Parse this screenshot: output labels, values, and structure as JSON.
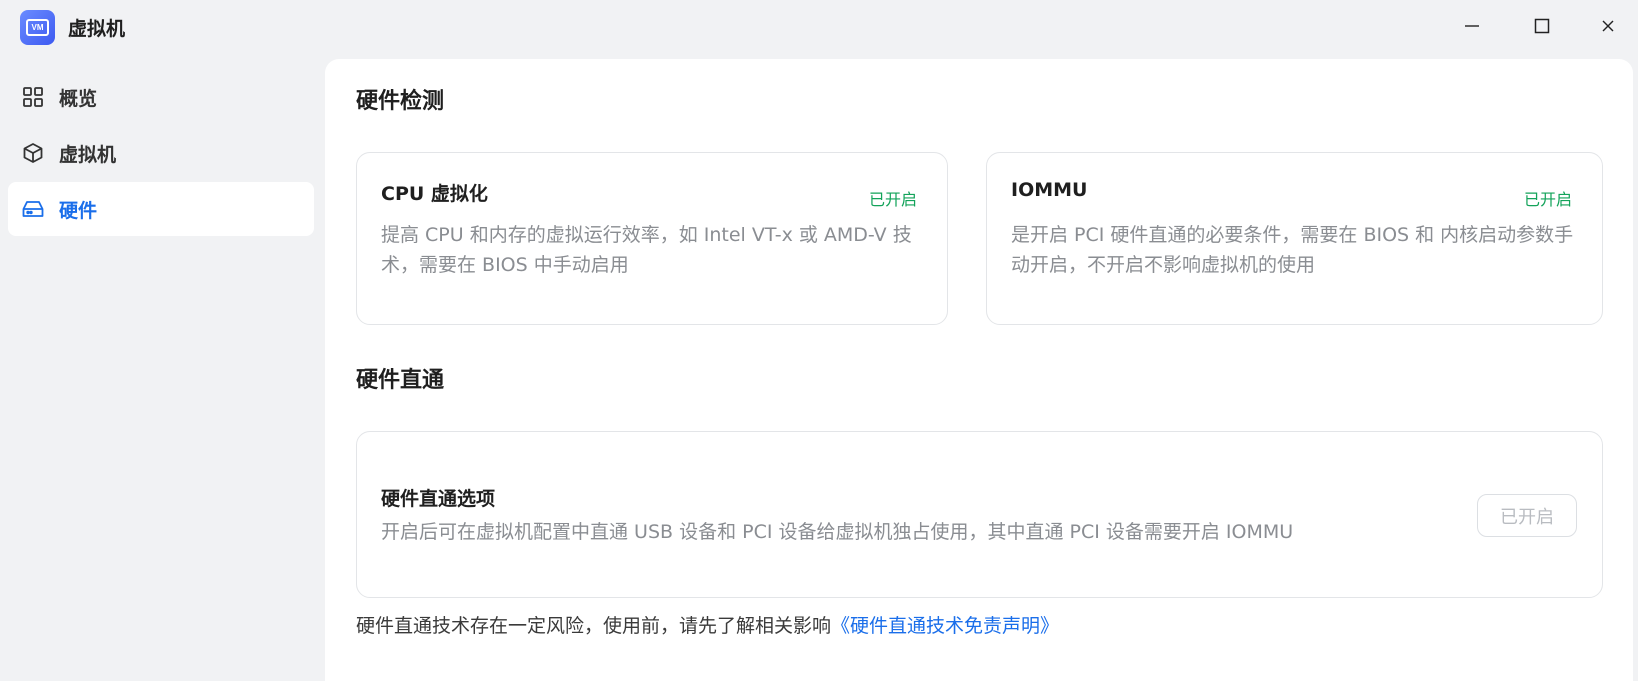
{
  "window": {
    "title": "虚拟机",
    "icon_text": "VM"
  },
  "sidebar": {
    "items": [
      {
        "label": "概览",
        "icon": "grid-icon",
        "active": false
      },
      {
        "label": "虚拟机",
        "icon": "cube-icon",
        "active": false
      },
      {
        "label": "硬件",
        "icon": "drive-icon",
        "active": true
      }
    ]
  },
  "main": {
    "detection": {
      "title": "硬件检测",
      "cards": [
        {
          "title": "CPU 虚拟化",
          "status": "已开启",
          "description": "提高 CPU 和内存的虚拟运行效率，如 Intel VT-x 或 AMD-V 技术，需要在 BIOS 中手动启用"
        },
        {
          "title": "IOMMU",
          "status": "已开启",
          "description": "是开启 PCI 硬件直通的必要条件，需要在 BIOS 和 内核启动参数手动开启，不开启不影响虚拟机的使用"
        }
      ]
    },
    "passthrough": {
      "title": "硬件直通",
      "option_title": "硬件直通选项",
      "option_description": "开启后可在虚拟机配置中直通 USB 设备和 PCI 设备给虚拟机独占使用，其中直通 PCI 设备需要开启 IOMMU",
      "button_label": "已开启"
    },
    "footer": {
      "prefix": "硬件直通技术存在一定风险，使用前，请先了解相关影响",
      "link": "《硬件直通技术免责声明》"
    }
  },
  "colors": {
    "accent": "#1a6eea",
    "status_green": "#13a35a",
    "muted_text": "#8a8d92",
    "background": "#f1f2f4"
  }
}
